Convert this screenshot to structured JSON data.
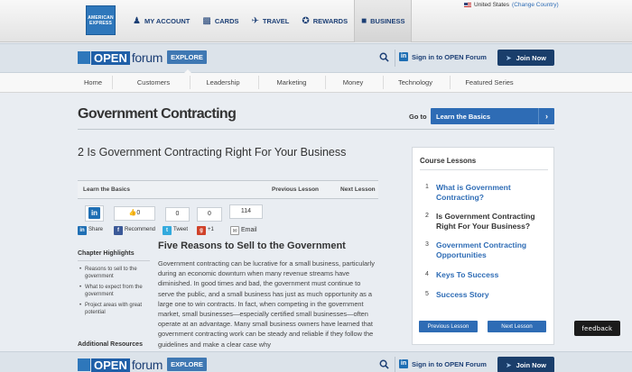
{
  "amex": {
    "logo_text": "AMERICAN EXPRESS",
    "nav": [
      {
        "label": "MY ACCOUNT",
        "icon": "person-icon"
      },
      {
        "label": "CARDS",
        "icon": "card-icon"
      },
      {
        "label": "TRAVEL",
        "icon": "plane-icon"
      },
      {
        "label": "REWARDS",
        "icon": "rewards-icon"
      },
      {
        "label": "BUSINESS",
        "icon": "briefcase-icon",
        "active": true
      }
    ],
    "country": "United States",
    "change_country": "(Change Country)"
  },
  "forum": {
    "logo_open": "OPEN",
    "logo_forum": "forum",
    "explore": "EXPLORE",
    "signin": "Sign in to OPEN Forum",
    "join": "Join Now"
  },
  "categories": [
    "Home",
    "Customers",
    "Leadership",
    "Marketing",
    "Money",
    "Technology",
    "Featured Series"
  ],
  "page": {
    "title": "Government Contracting",
    "goto_label": "Go to",
    "goto_value": "Learn the Basics"
  },
  "lesson": {
    "title": "2 Is Government Contracting Right For Your Business",
    "nav_section": "Learn the Basics",
    "previous": "Previous Lesson",
    "next": "Next Lesson"
  },
  "share": {
    "recommend_count": "0",
    "tweet_count": "0",
    "plusone_count": "0",
    "email_count": "114",
    "share_label": "Share",
    "recommend_label": "Recommend",
    "tweet_label": "Tweet",
    "plusone_label": "+1",
    "email_label": "Email"
  },
  "highlights": {
    "title": "Chapter Highlights",
    "items": [
      "Reasons to sell to the government",
      "What to expect from the government",
      "Project areas with great potential"
    ],
    "additional": "Additional Resources"
  },
  "article": {
    "heading": "Five Reasons to Sell to the Government",
    "body": "Government contracting can be lucrative for a small business, particularly during an economic downturn when many revenue streams have diminished. In good times and bad, the government must continue to serve the public, and a small business has just as much opportunity as a large one to win contracts. In fact, when competing in the government market, small businesses—especially certified small businesses—often operate at an advantage. Many small business owners have learned that government contracting work can be steady and reliable if they follow the guidelines and make a clear case why"
  },
  "course": {
    "title": "Course Lessons",
    "lessons": [
      {
        "num": "1",
        "label": "What is Government Contracting?"
      },
      {
        "num": "2",
        "label": "Is Government Contracting Right For Your Business?",
        "current": true
      },
      {
        "num": "3",
        "label": "Government Contracting Opportunities"
      },
      {
        "num": "4",
        "label": "Keys To Success"
      },
      {
        "num": "5",
        "label": "Success Story"
      }
    ],
    "prev_btn": "Previous Lesson",
    "next_btn": "Next Lesson"
  },
  "feedback": "feedback",
  "colors": {
    "accent": "#2e6cb5",
    "navy": "#1a3e6b",
    "background": "#e9edf2"
  }
}
